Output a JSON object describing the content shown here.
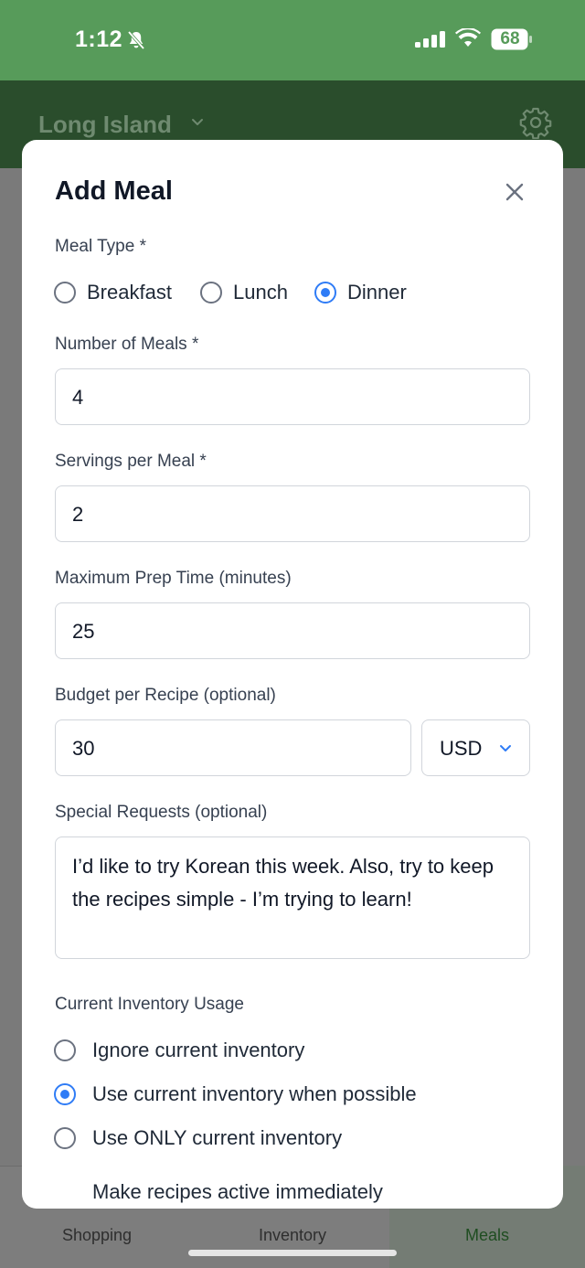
{
  "status_bar": {
    "time": "1:12",
    "battery": "68",
    "icons": [
      "bell-slash-icon",
      "signal-icon",
      "wifi-icon",
      "battery-icon"
    ]
  },
  "header": {
    "location": "Long Island",
    "icons": [
      "chevron-down-icon",
      "gear-icon"
    ]
  },
  "modal": {
    "title": "Add Meal",
    "close_icon": "close-icon",
    "meal_type": {
      "label": "Meal Type *",
      "options": [
        "Breakfast",
        "Lunch",
        "Dinner"
      ],
      "selected": "Dinner"
    },
    "number_of_meals": {
      "label": "Number of Meals *",
      "value": "4"
    },
    "servings_per_meal": {
      "label": "Servings per Meal *",
      "value": "2"
    },
    "max_prep_time": {
      "label": "Maximum Prep Time (minutes)",
      "value": "25"
    },
    "budget": {
      "label": "Budget per Recipe (optional)",
      "value": "30",
      "currency": "USD"
    },
    "special_requests": {
      "label": "Special Requests (optional)",
      "value": "I’d like to try Korean this week. Also, try to keep the recipes simple - I’m trying to learn!"
    },
    "inventory_usage": {
      "label": "Current Inventory Usage",
      "options": [
        "Ignore current inventory",
        "Use current inventory when possible",
        "Use ONLY current inventory"
      ],
      "selected": "Use current inventory when possible"
    },
    "activate_label": "Make recipes active immediately"
  },
  "tabs": [
    {
      "label": "Shopping",
      "active": false
    },
    {
      "label": "Inventory",
      "active": false
    },
    {
      "label": "Meals",
      "active": true
    }
  ],
  "colors": {
    "status_bar": "#579b5a",
    "header": "#2a4d2c",
    "accent_radio": "#2f7cf6",
    "overlay": "#7a7a7a"
  }
}
